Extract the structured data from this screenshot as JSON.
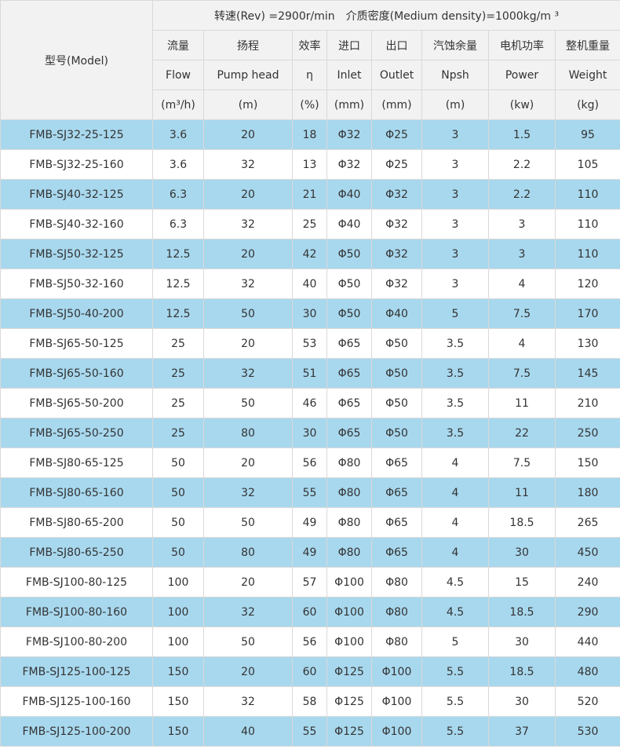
{
  "header": {
    "model_label": "型号(Model)",
    "conditions": "转速(Rev) =2900r/min　介质密度(Medium density)=1000kg/m ³",
    "columns_cn": [
      "流量",
      "扬程",
      "效率",
      "进口",
      "出口",
      "汽蚀余量",
      "电机功率",
      "整机重量"
    ],
    "columns_en": [
      "Flow",
      "Pump head",
      "η",
      "Inlet",
      "Outlet",
      "Npsh",
      "Power",
      "Weight"
    ],
    "units": [
      "(m³/h)",
      "(m)",
      "(%)",
      "(mm)",
      "(mm)",
      "(m)",
      "(kw)",
      "(kg)"
    ]
  },
  "rows": [
    [
      "FMB-SJ32-25-125",
      "3.6",
      "20",
      "18",
      "Φ32",
      "Φ25",
      "3",
      "1.5",
      "95"
    ],
    [
      "FMB-SJ32-25-160",
      "3.6",
      "32",
      "13",
      "Φ32",
      "Φ25",
      "3",
      "2.2",
      "105"
    ],
    [
      "FMB-SJ40-32-125",
      "6.3",
      "20",
      "21",
      "Φ40",
      "Φ32",
      "3",
      "2.2",
      "110"
    ],
    [
      "FMB-SJ40-32-160",
      "6.3",
      "32",
      "25",
      "Φ40",
      "Φ32",
      "3",
      "3",
      "110"
    ],
    [
      "FMB-SJ50-32-125",
      "12.5",
      "20",
      "42",
      "Φ50",
      "Φ32",
      "3",
      "3",
      "110"
    ],
    [
      "FMB-SJ50-32-160",
      "12.5",
      "32",
      "40",
      "Φ50",
      "Φ32",
      "3",
      "4",
      "120"
    ],
    [
      "FMB-SJ50-40-200",
      "12.5",
      "50",
      "30",
      "Φ50",
      "Φ40",
      "5",
      "7.5",
      "170"
    ],
    [
      "FMB-SJ65-50-125",
      "25",
      "20",
      "53",
      "Φ65",
      "Φ50",
      "3.5",
      "4",
      "130"
    ],
    [
      "FMB-SJ65-50-160",
      "25",
      "32",
      "51",
      "Φ65",
      "Φ50",
      "3.5",
      "7.5",
      "145"
    ],
    [
      "FMB-SJ65-50-200",
      "25",
      "50",
      "46",
      "Φ65",
      "Φ50",
      "3.5",
      "11",
      "210"
    ],
    [
      "FMB-SJ65-50-250",
      "25",
      "80",
      "30",
      "Φ65",
      "Φ50",
      "3.5",
      "22",
      "250"
    ],
    [
      "FMB-SJ80-65-125",
      "50",
      "20",
      "56",
      "Φ80",
      "Φ65",
      "4",
      "7.5",
      "150"
    ],
    [
      "FMB-SJ80-65-160",
      "50",
      "32",
      "55",
      "Φ80",
      "Φ65",
      "4",
      "11",
      "180"
    ],
    [
      "FMB-SJ80-65-200",
      "50",
      "50",
      "49",
      "Φ80",
      "Φ65",
      "4",
      "18.5",
      "265"
    ],
    [
      "FMB-SJ80-65-250",
      "50",
      "80",
      "49",
      "Φ80",
      "Φ65",
      "4",
      "30",
      "450"
    ],
    [
      "FMB-SJ100-80-125",
      "100",
      "20",
      "57",
      "Φ100",
      "Φ80",
      "4.5",
      "15",
      "240"
    ],
    [
      "FMB-SJ100-80-160",
      "100",
      "32",
      "60",
      "Φ100",
      "Φ80",
      "4.5",
      "18.5",
      "290"
    ],
    [
      "FMB-SJ100-80-200",
      "100",
      "50",
      "56",
      "Φ100",
      "Φ80",
      "5",
      "30",
      "440"
    ],
    [
      "FMB-SJ125-100-125",
      "150",
      "20",
      "60",
      "Φ125",
      "Φ100",
      "5.5",
      "18.5",
      "480"
    ],
    [
      "FMB-SJ125-100-160",
      "150",
      "32",
      "58",
      "Φ125",
      "Φ100",
      "5.5",
      "30",
      "520"
    ],
    [
      "FMB-SJ125-100-200",
      "150",
      "40",
      "55",
      "Φ125",
      "Φ100",
      "5.5",
      "37",
      "530"
    ]
  ],
  "colors": {
    "header_bg": "#f2f2f2",
    "stripe_bg": "#a8d8ee",
    "plain_bg": "#ffffff",
    "border": "#d9d9d9",
    "text": "#333333"
  }
}
